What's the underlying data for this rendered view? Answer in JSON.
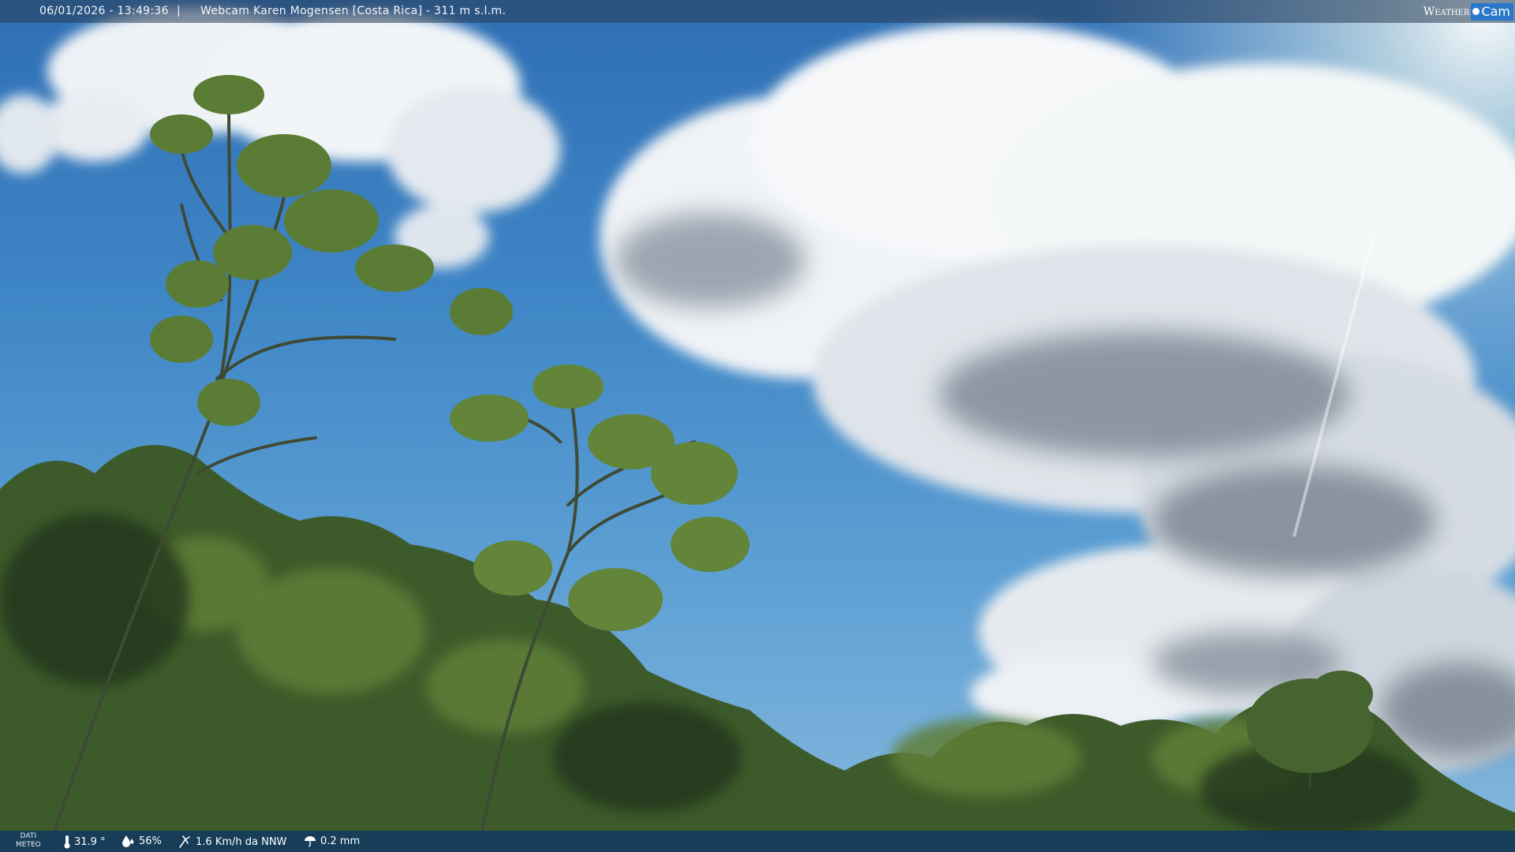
{
  "overlay": {
    "datetime": "06/01/2026 - 13:49:36",
    "separator": "|",
    "title": "Webcam Karen Mogensen [Costa Rica]  - 311 m s.l.m.",
    "brand": {
      "weather": "Weather",
      "cam": "Cam",
      "color": "#2a78c9"
    }
  },
  "weather_bar": {
    "label_line1": "DATI",
    "label_line2": "METEO",
    "temperature": "31.9 °",
    "humidity": "56%",
    "wind": "1.6 Km/h da NNW",
    "rain": "0.2 mm",
    "icons": [
      "thermometer-icon",
      "humidity-icon",
      "wind-icon",
      "rain-icon"
    ]
  },
  "scene": {
    "description_colors": {
      "sky": "#3f86c6",
      "cloud": "#f2f5f8",
      "cloud_shadow": "#7f8b98",
      "foliage": "#3f5d2a"
    }
  }
}
